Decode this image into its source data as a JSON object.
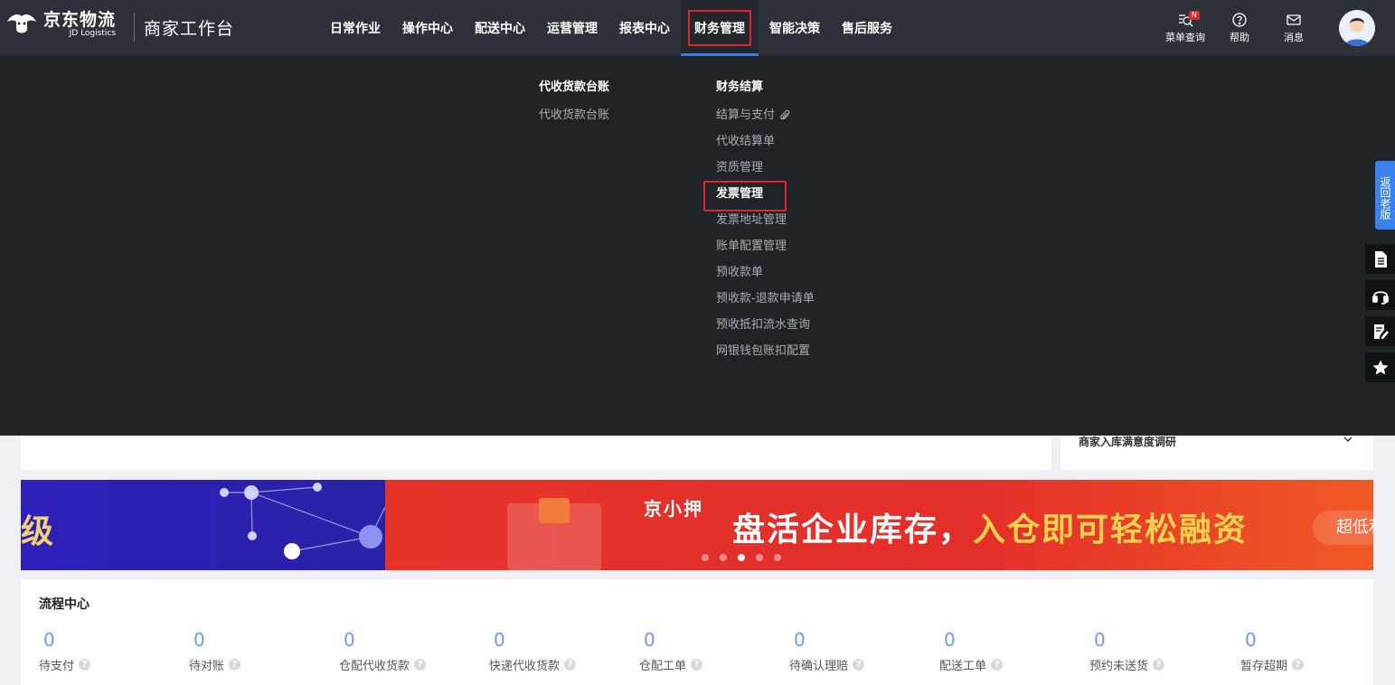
{
  "header": {
    "logo_cn": "京东物流",
    "logo_en": "JD Logistics",
    "workbench": "商家工作台",
    "nav": [
      {
        "label": "日常作业"
      },
      {
        "label": "操作中心"
      },
      {
        "label": "配送中心"
      },
      {
        "label": "运营管理"
      },
      {
        "label": "报表中心"
      },
      {
        "label": "财务管理",
        "active": true
      },
      {
        "label": "智能决策"
      },
      {
        "label": "售后服务"
      }
    ],
    "tools": {
      "menu_search": "菜单查询",
      "menu_badge": "N",
      "help": "帮助",
      "messages": "消息"
    }
  },
  "dropdown": {
    "col1": {
      "title": "代收货款台账",
      "items": [
        "代收货款台账"
      ]
    },
    "col2": {
      "title": "财务结算",
      "items": [
        "结算与支付",
        "代收结算单",
        "资质管理",
        "发票管理",
        "发票地址管理",
        "账单配置管理",
        "预收款单",
        "预收款-退款申请单",
        "预收抵扣流水查询",
        "网银钱包账扣配置"
      ],
      "highlighted": "发票管理"
    }
  },
  "survey": {
    "label": "商家入库满意度调研"
  },
  "banner": {
    "left_text": "级",
    "brand": "京小押",
    "slogan_white": "盘活企业库存，",
    "slogan_yellow": "入仓即可轻松融资",
    "pill": "超低利",
    "active_dot": 3,
    "dot_count": 5
  },
  "flow": {
    "title": "流程中心",
    "metrics": [
      {
        "value": "0",
        "label": "待支付"
      },
      {
        "value": "0",
        "label": "待对账"
      },
      {
        "value": "0",
        "label": "仓配代收货款"
      },
      {
        "value": "0",
        "label": "快递代收货款"
      },
      {
        "value": "0",
        "label": "仓配工单"
      },
      {
        "value": "0",
        "label": "待确认理赔"
      },
      {
        "value": "0",
        "label": "配送工单"
      },
      {
        "value": "0",
        "label": "预约未送货"
      },
      {
        "value": "0",
        "label": "暂存超期"
      }
    ]
  },
  "side": {
    "back_old": "返回老版"
  }
}
